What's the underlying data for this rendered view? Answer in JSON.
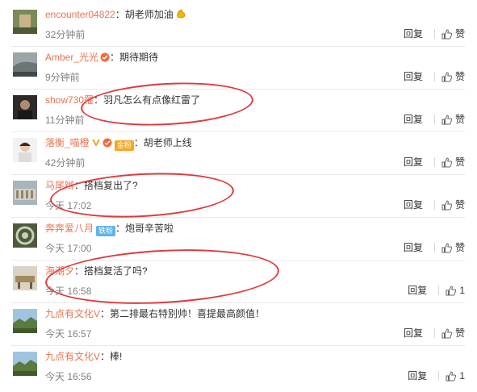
{
  "comments": [
    {
      "user": "encounter04822",
      "sep": "：",
      "text": "胡老师加油",
      "emoji": "muscle-emoji",
      "time": "32分钟前",
      "reply": "回复",
      "like": "赞"
    },
    {
      "user": "Amber_光光",
      "sep": "：",
      "text": "期待期待",
      "time": "9分钟前",
      "reply": "回复",
      "like": "赞"
    },
    {
      "user": "show730罹",
      "sep": "：",
      "text": "羽凡怎么有点像红雷了",
      "time": "11分钟前",
      "reply": "回复",
      "like": "赞"
    },
    {
      "user": "落衡_喵橙",
      "badge": "金粉",
      "sep": "：",
      "text": "胡老师上线",
      "time": "42分钟前",
      "reply": "回复",
      "like": "赞"
    },
    {
      "user": "马尾辫",
      "sep": "：",
      "text": "搭档复出了?",
      "time": "今天 17:02",
      "reply": "回复",
      "like": "赞"
    },
    {
      "user": "奔奔爱八月",
      "badge": "铁粉",
      "sep": "：",
      "text": "炮哥辛苦啦",
      "time": "今天 17:00",
      "reply": "回复",
      "like": "赞"
    },
    {
      "user": "海潮夕",
      "sep": "：",
      "text": "搭档复活了吗?",
      "time": "今天 16:58",
      "reply": "回复",
      "like": "1"
    },
    {
      "user": "九点有文化V",
      "sep": "：",
      "text": "第二排最右特别帅！喜提最高颜值！",
      "time": "今天 16:57",
      "reply": "回复",
      "like": "赞"
    },
    {
      "user": "九点有文化V",
      "sep": "：",
      "text": "棒!",
      "time": "今天 16:56",
      "reply": "回复",
      "like": "1"
    }
  ],
  "colors": {
    "username": "#eb7350",
    "annotation": "#e0393e",
    "time": "#808080"
  }
}
